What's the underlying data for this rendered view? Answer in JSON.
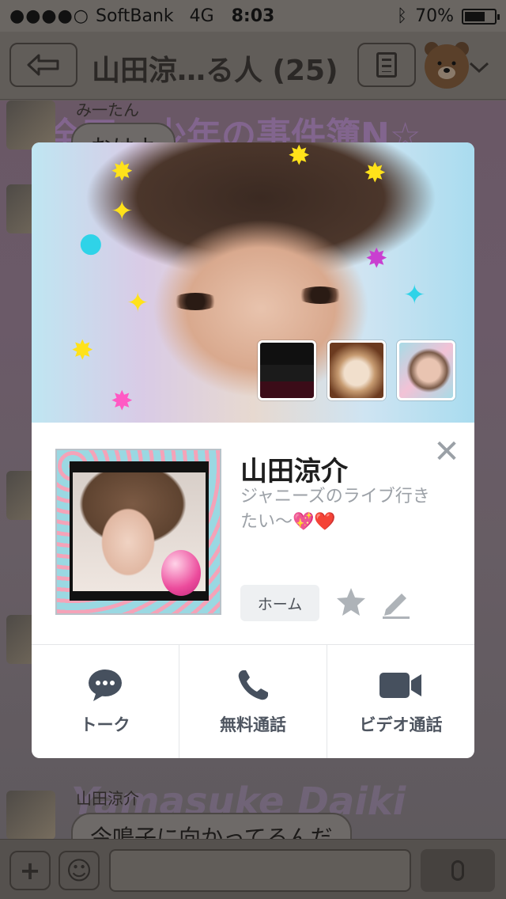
{
  "status_bar": {
    "signal": "●●●●○",
    "carrier": "SoftBank",
    "network": "4G",
    "time": "8:03",
    "battery": "70%",
    "battery_level": 0.7
  },
  "nav": {
    "title": "山田涼…る人 (25)"
  },
  "chat": {
    "banner": "全田一少年の事件簿N☆",
    "messages": [
      {
        "sender": "み一たん",
        "text": "おはよ"
      },
      {
        "sender": "山田涼介",
        "text": "今鳴子に向かってるんだ"
      }
    ],
    "deco_text": "Yamasuke  Daiki"
  },
  "profile": {
    "name": "山田涼介",
    "status_message": "ジャニーズのライブ行きたい〜",
    "status_emoji": "💖❤️",
    "home_label": "ホーム",
    "close_symbol": "✕"
  },
  "actions": [
    {
      "icon": "chat-bubble-icon",
      "label": "トーク"
    },
    {
      "icon": "phone-icon",
      "label": "無料通話"
    },
    {
      "icon": "video-camera-icon",
      "label": "ビデオ通話"
    }
  ],
  "colors": {
    "icon_dark": "#46505e",
    "label": "#4e5560",
    "muted_gray": "#aeb3b8",
    "heart_red": "#e0334d"
  }
}
